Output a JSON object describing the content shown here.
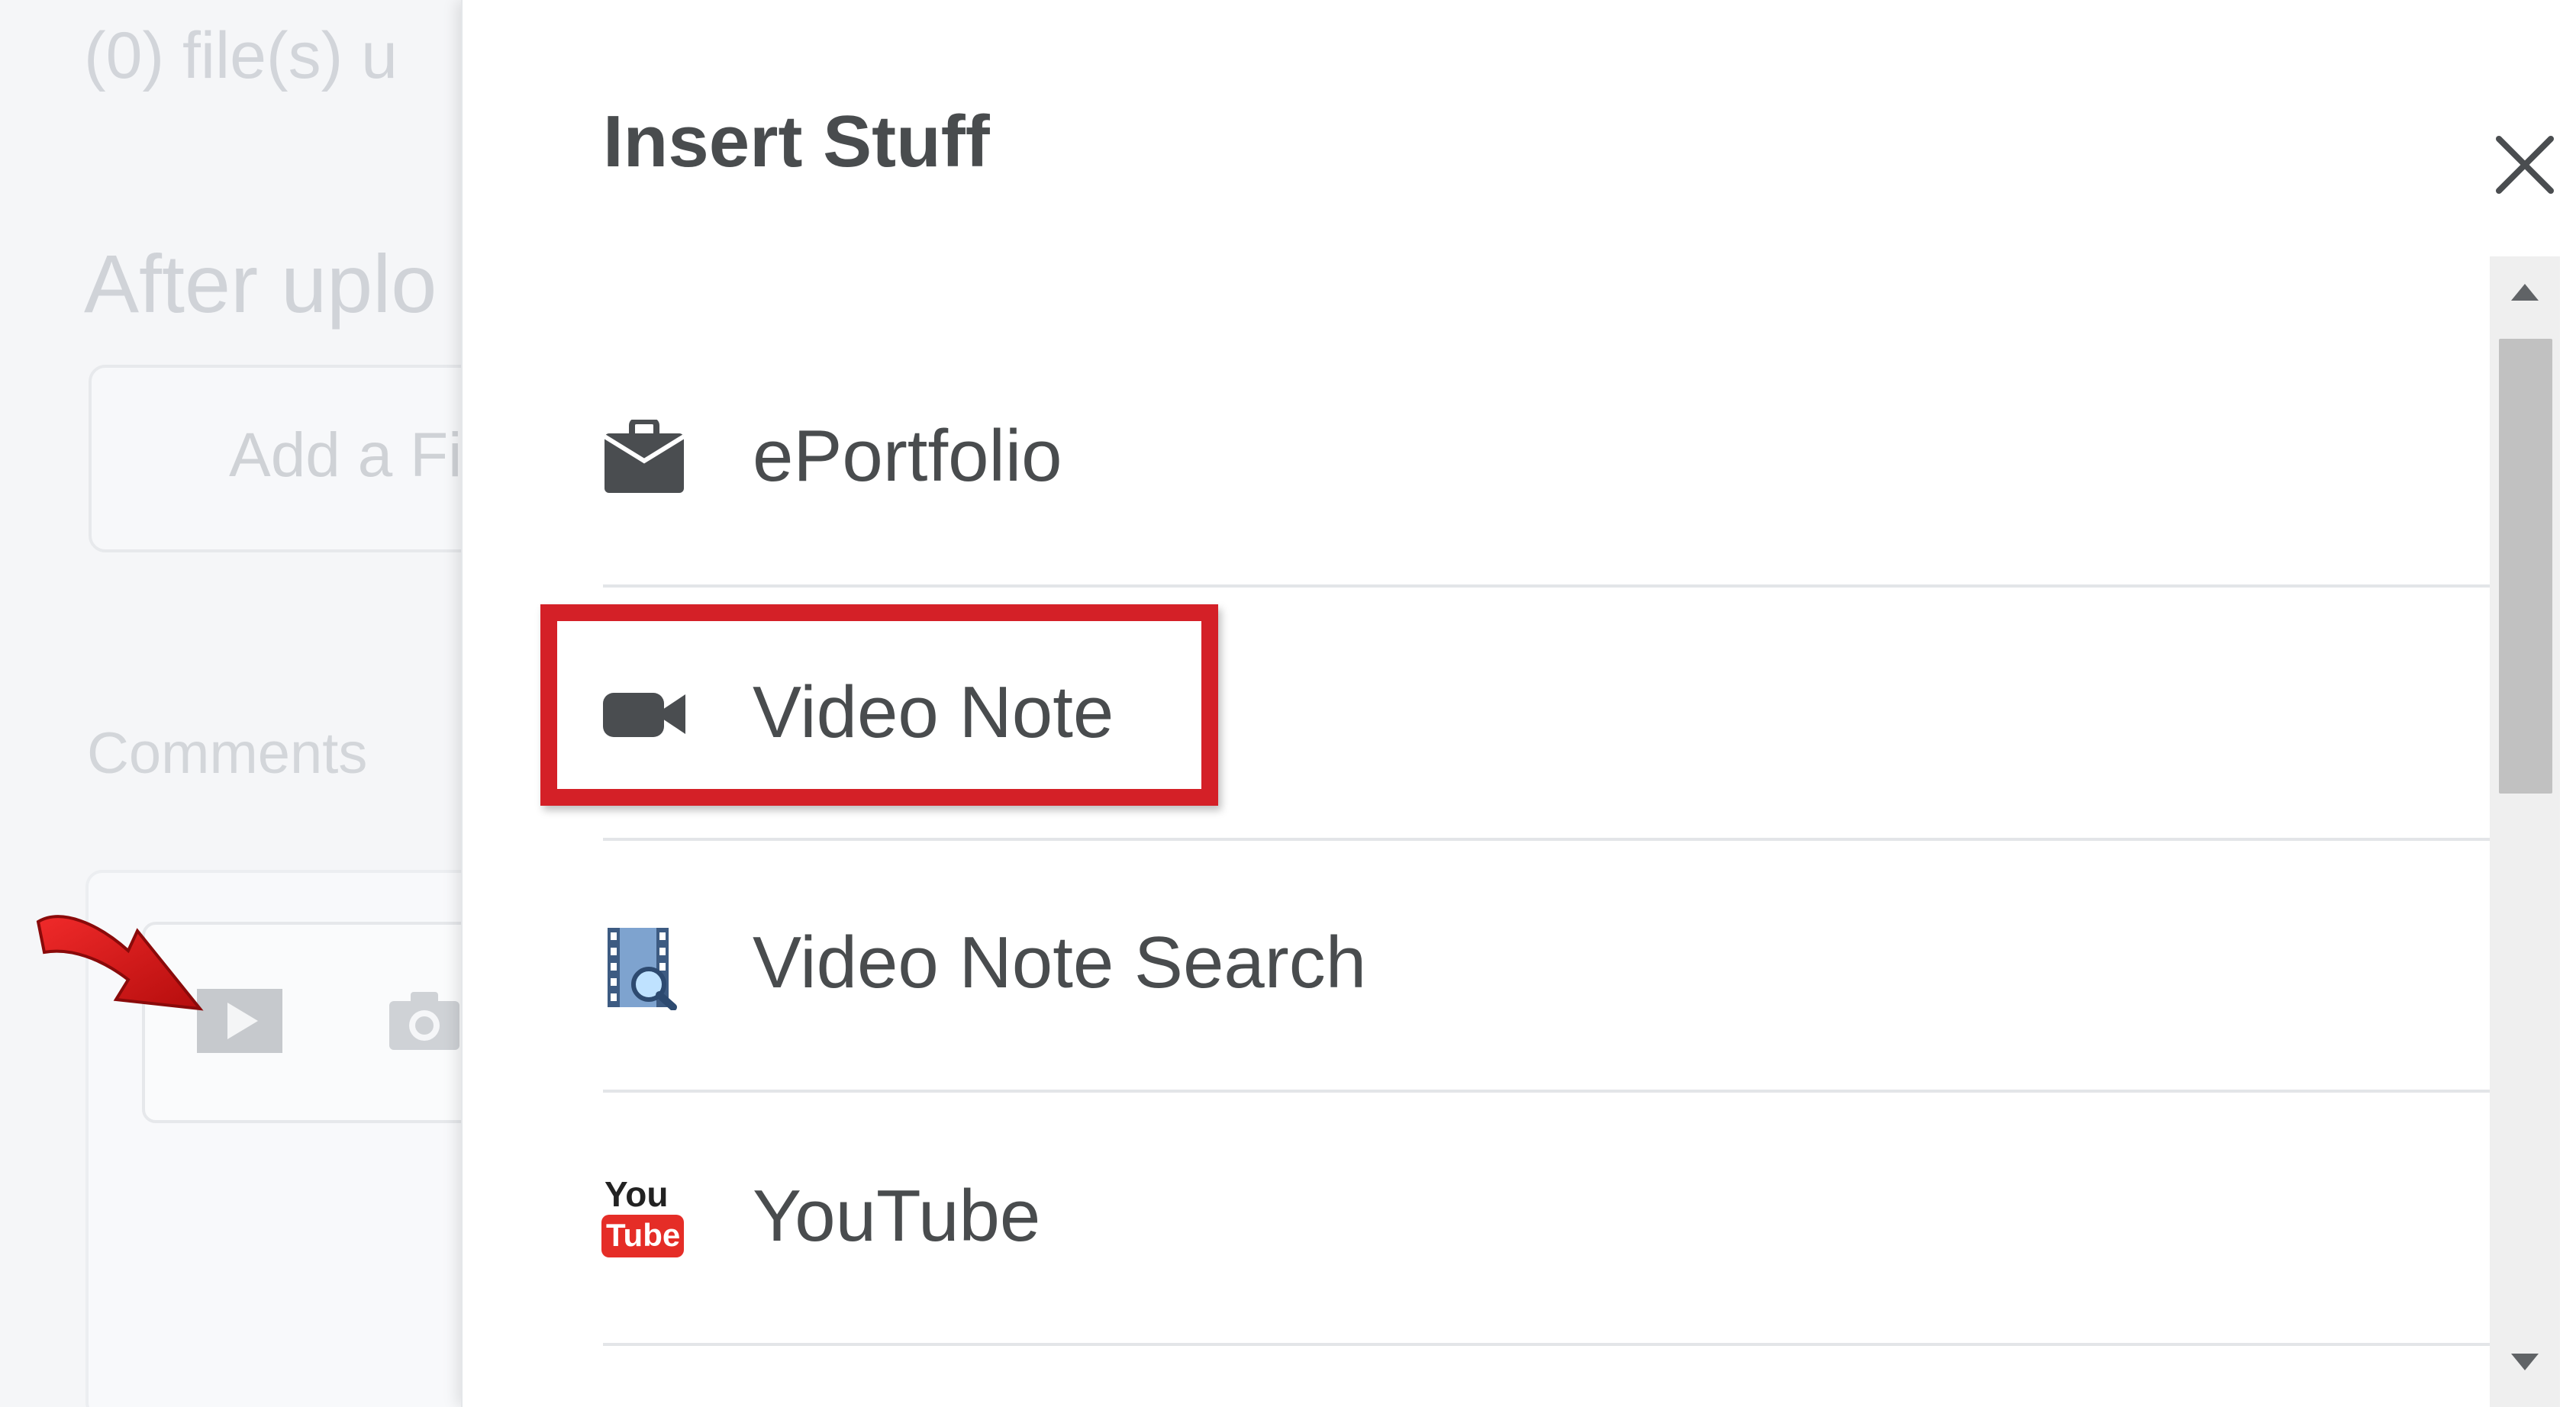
{
  "background": {
    "files_text": "(0) file(s) u",
    "after_upload_text": "After uplo",
    "add_file_label": "Add a Fi",
    "comments_label": "Comments"
  },
  "panel": {
    "title": "Insert Stuff",
    "items": [
      {
        "label": "ePortfolio",
        "icon": "briefcase-icon"
      },
      {
        "label": "Video Note",
        "icon": "video-camera-icon"
      },
      {
        "label": "Video Note Search",
        "icon": "film-search-icon"
      },
      {
        "label": "YouTube",
        "icon": "youtube-icon"
      }
    ]
  },
  "annotation": {
    "highlight_color": "#d42027",
    "highlighted_item": "Video Note"
  },
  "colors": {
    "text": "#494c4e",
    "divider": "#e3e5e8",
    "youtube_red": "#e52d27"
  },
  "youtube_icon": {
    "top": "You",
    "bottom": "Tube"
  }
}
